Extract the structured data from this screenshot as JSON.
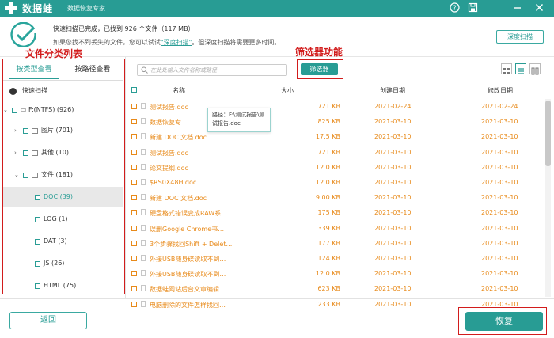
{
  "titlebar": {
    "app_name": "数据蛙",
    "subtitle": "数据恢复专家",
    "buttons": [
      "help-icon",
      "save-icon",
      "minimize-icon",
      "close-icon"
    ]
  },
  "header": {
    "status_text": "快速扫描已完成，已找到 926 个文件（117 MB）",
    "hint_prefix": "如果您找不到丢失的文件，您可以试试",
    "hint_link": "\"深度扫描\"",
    "hint_suffix": "。但深度扫描将需要更多时间。",
    "deep_scan_label": "深度扫描"
  },
  "annotations": {
    "left_label": "文件分类列表",
    "filter_label": "筛选器功能"
  },
  "left_panel": {
    "tabs": [
      {
        "label": "按类型查看",
        "active": true
      },
      {
        "label": "按路径查看",
        "active": false
      }
    ],
    "quick_scan_label": "快速扫描",
    "tree": [
      {
        "label": "F:(NTFS) (926)"
      },
      {
        "label": "图片 (701)"
      },
      {
        "label": "其他 (10)"
      },
      {
        "label": "文件 (181)"
      },
      {
        "label": "DOC (39)"
      },
      {
        "label": "LOG (1)"
      },
      {
        "label": "DAT (3)"
      },
      {
        "label": "JS (26)"
      },
      {
        "label": "HTML (75)"
      }
    ]
  },
  "toolbar": {
    "search_placeholder": "在此处输入文件名称或路径",
    "filter_label": "筛选器",
    "view_modes": [
      "grid-view-icon",
      "list-view-icon",
      "detail-view-icon"
    ]
  },
  "table": {
    "columns": [
      "名称",
      "大小",
      "创建日期",
      "修改日期"
    ],
    "rows": [
      {
        "name": "测试报告.doc",
        "size": "721 KB",
        "created": "2021-02-24",
        "modified": "2021-02-24"
      },
      {
        "name": "数据恢复专",
        "size": "825 KB",
        "created": "2021-03-10",
        "modified": "2021-03-10"
      },
      {
        "name": "新建 DOC 文档.doc",
        "size": "17.5 KB",
        "created": "2021-03-10",
        "modified": "2021-03-10"
      },
      {
        "name": "测试报告.doc",
        "size": "721 KB",
        "created": "2021-03-10",
        "modified": "2021-03-10"
      },
      {
        "name": "论文提纲.doc",
        "size": "12.0 KB",
        "created": "2021-03-10",
        "modified": "2021-03-10"
      },
      {
        "name": "$RS0X48H.doc",
        "size": "12.0 KB",
        "created": "2021-03-10",
        "modified": "2021-03-10"
      },
      {
        "name": "新建 DOC 文档.doc",
        "size": "9.00 KB",
        "created": "2021-03-10",
        "modified": "2021-03-10"
      },
      {
        "name": "硬盘格式错误变成RAW系…",
        "size": "175 KB",
        "created": "2021-03-10",
        "modified": "2021-03-10"
      },
      {
        "name": "误删Google Chrome书…",
        "size": "339 KB",
        "created": "2021-03-10",
        "modified": "2021-03-10"
      },
      {
        "name": "3个步骤找回Shift + Delet…",
        "size": "177 KB",
        "created": "2021-03-10",
        "modified": "2021-03-10"
      },
      {
        "name": "外接USB随身碟读取不到…",
        "size": "124 KB",
        "created": "2021-03-10",
        "modified": "2021-03-10"
      },
      {
        "name": "外接USB随身碟读取不到…",
        "size": "12.0 KB",
        "created": "2021-03-10",
        "modified": "2021-03-10"
      },
      {
        "name": "数据蛙网站后台文章编辑…",
        "size": "623 KB",
        "created": "2021-03-10",
        "modified": "2021-03-10"
      },
      {
        "name": "电脑删除的文件怎样找回…",
        "size": "233 KB",
        "created": "2021-03-10",
        "modified": "2021-03-10"
      }
    ]
  },
  "tooltip": {
    "label": "路径：",
    "value": "F:\\测试报告\\测试报告.doc"
  },
  "footer": {
    "back_label": "返回",
    "recover_label": "恢复"
  },
  "colors": {
    "accent": "#289c94",
    "file_text": "#e88a1a",
    "annotation": "#d21c1c"
  }
}
